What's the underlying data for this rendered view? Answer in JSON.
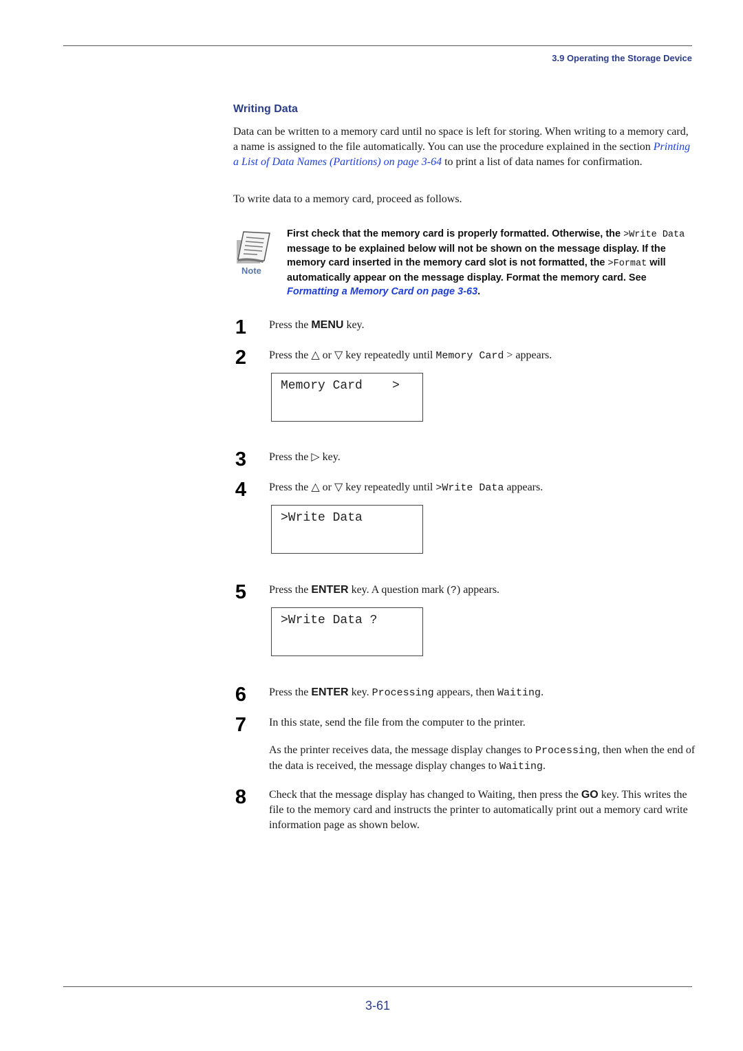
{
  "header": {
    "running_head": "3.9 Operating the Storage Device"
  },
  "section": {
    "title": "Writing Data",
    "intro": {
      "before_link": "Data can be written to a memory card until no space is left for storing. When writing to a memory card, a name is assigned to the file automatically. You can use the procedure explained in the section ",
      "link": "Printing a List of Data Names (Partitions) on page 3-64",
      "after_link": " to print a list of data names for confirmation."
    },
    "lead": "To write data to a memory card, proceed as follows."
  },
  "note": {
    "label": "Note",
    "icon": "note-paper-icon",
    "t1": "First check that the memory card is properly formatted. Otherwise, the ",
    "code1": ">Write Data",
    "t2": " message to be explained below will not be shown on the message display. If the memory card inserted in the memory card slot is not formatted, the ",
    "code2": ">Format",
    "t3": " will automatically appear on the message display. Format the memory card. See ",
    "link": "Formatting a Memory Card on page 3-63",
    "t4": "."
  },
  "steps": [
    {
      "num": "1",
      "a": "Press the ",
      "key": "MENU",
      "b": " key."
    },
    {
      "num": "2",
      "a": "Press the △ or ▽ key repeatedly until ",
      "code": "Memory Card",
      "b": " > appears."
    },
    {
      "num": "3",
      "a": "Press the ▷ key."
    },
    {
      "num": "4",
      "a": "Press the △ or ▽ key repeatedly until ",
      "code": ">Write Data",
      "b": " appears."
    },
    {
      "num": "5",
      "a": "Press the ",
      "key": "ENTER",
      "b": " key. A question mark (",
      "code": "?",
      "c": ") appears."
    },
    {
      "num": "6",
      "a": "Press the ",
      "key": "ENTER",
      "b": " key. ",
      "code": "Processing",
      "c": " appears, then ",
      "code2": "Waiting",
      "d": "."
    },
    {
      "num": "7",
      "a": "In this state, send the file from the computer to the printer.",
      "sub_a": "As the printer receives data, the message display changes to ",
      "sub_code": "Processing",
      "sub_b": ", then when the end of the data is received, the message display changes to ",
      "sub_code2": "Waiting",
      "sub_c": "."
    },
    {
      "num": "8",
      "a": "Check that the message display has changed to Waiting, then press the ",
      "key": "GO",
      "b": " key. This writes the file to the memory card and instructs the printer to automatically print out a memory card write information page as shown below."
    }
  ],
  "displays": [
    {
      "line1": "Memory Card    >"
    },
    {
      "line1": ">Write Data"
    },
    {
      "line1": ">Write Data ?"
    }
  ],
  "footer": {
    "page_number": "3-61"
  }
}
